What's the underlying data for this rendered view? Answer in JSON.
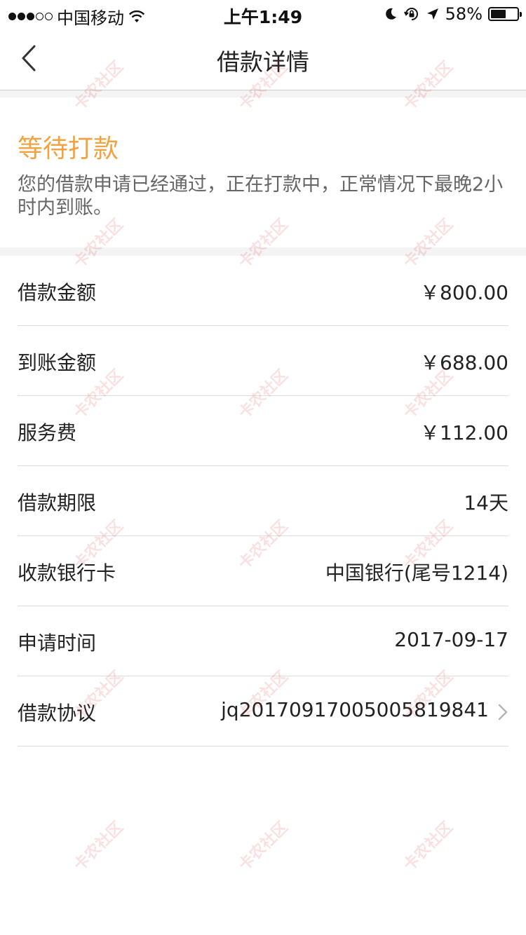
{
  "status_bar": {
    "carrier": "中国移动",
    "time": "上午1:49",
    "battery_percent": "58%",
    "battery_level": 0.58
  },
  "nav": {
    "title": "借款详情"
  },
  "status": {
    "title": "等待打款",
    "description": "您的借款申请已经通过，正在打款中，正常情况下最晚2小时内到账。"
  },
  "details": [
    {
      "label": "借款金额",
      "value": "￥800.00"
    },
    {
      "label": "到账金额",
      "value": "￥688.00"
    },
    {
      "label": "服务费",
      "value": "￥112.00"
    },
    {
      "label": "借款期限",
      "value": "14天"
    },
    {
      "label": "收款银行卡",
      "value": "中国银行(尾号1214)"
    },
    {
      "label": "申请时间",
      "value": "2017-09-17"
    },
    {
      "label": "借款协议",
      "value": "jq20170917005005819841"
    }
  ],
  "watermark": "卡农社区",
  "colors": {
    "accent": "#f1a341",
    "divider": "#dcdcdc",
    "section_bg": "#f4f4f4"
  }
}
